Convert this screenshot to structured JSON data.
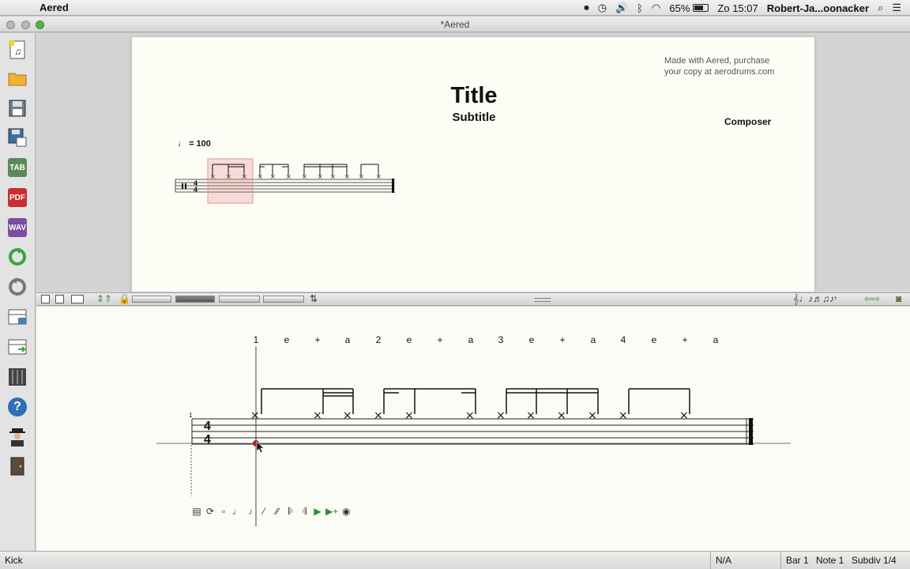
{
  "menubar": {
    "app_name": "Aered",
    "battery": "65%",
    "clock": "Zo 15:07",
    "user": "Robert-Ja...oonacker"
  },
  "window": {
    "title": "*Aered"
  },
  "score": {
    "title": "Title",
    "subtitle": "Subtitle",
    "composer": "Composer",
    "promo_line1": "Made with Aered, purchase",
    "promo_line2": "your copy at aerodrums.com",
    "tempo": "= 100"
  },
  "editor": {
    "measure_number": "1",
    "counts": [
      "1",
      "e",
      "+",
      "a",
      "2",
      "e",
      "+",
      "a",
      "3",
      "e",
      "+",
      "a",
      "4",
      "e",
      "+",
      "a"
    ]
  },
  "status": {
    "instrument": "Kick",
    "value": "N/A",
    "bar": "Bar 1",
    "note": "Note 1",
    "subdiv": "Subdiv 1/4"
  },
  "toolbar": {
    "tab_label": "TAB",
    "pdf_label": "PDF",
    "wav_label": "WAV",
    "help_label": "?"
  }
}
